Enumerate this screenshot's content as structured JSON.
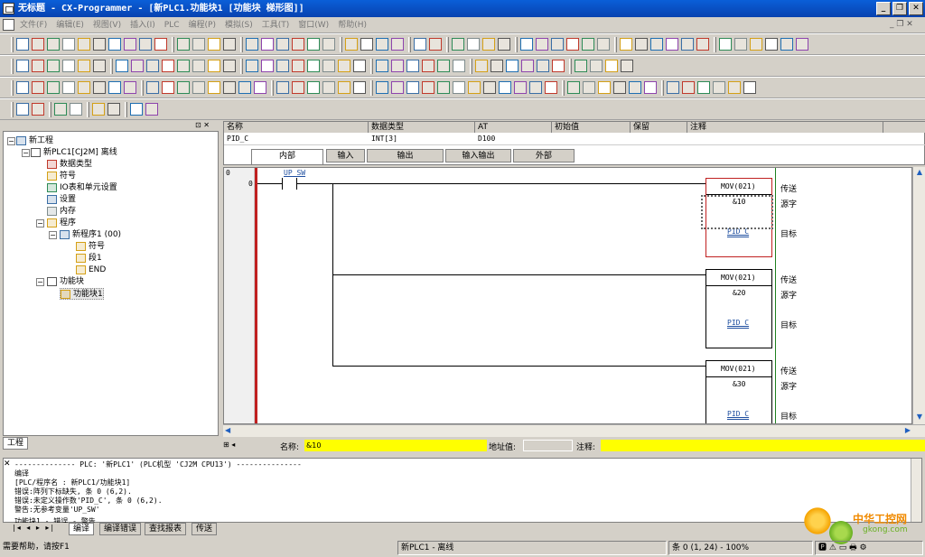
{
  "window": {
    "title": "无标题 - CX-Programmer - [新PLC1.功能块1 [功能块 梯形图]]",
    "min": "_",
    "restore": "❐",
    "close": "✕"
  },
  "menu": [
    "文件(F)",
    "编辑(E)",
    "视图(V)",
    "插入(I)",
    "PLC",
    "编程(P)",
    "模拟(S)",
    "工具(T)",
    "窗口(W)",
    "帮助(H)"
  ],
  "tree": {
    "root": "新工程",
    "plc": "新PLC1[CJ2M] 离线",
    "items": [
      "数据类型",
      "符号",
      "IO表和单元设置",
      "设置",
      "内存",
      "程序",
      "新程序1 (00)",
      "符号",
      "段1",
      "END",
      "功能块",
      "功能块1"
    ],
    "tab": "工程"
  },
  "vartable": {
    "headers": [
      "名称",
      "数据类型",
      "AT",
      "初始值",
      "保留",
      "注释"
    ],
    "row": [
      "PID_C",
      "INT[3]",
      "D100",
      "",
      "",
      ""
    ],
    "tabs": [
      "内部",
      "输入",
      "输出",
      "输入输出",
      "外部"
    ]
  },
  "ladder": {
    "rung_no": "0",
    "step_no": "0",
    "contact": "UP_SW",
    "blocks": [
      {
        "name": "MOV(021)",
        "src": "&10",
        "dst": "PID_C"
      },
      {
        "name": "MOV(021)",
        "src": "&20",
        "dst": "PID_C"
      },
      {
        "name": "MOV(021)",
        "src": "&30",
        "dst": "PID_C"
      }
    ],
    "labels": {
      "transfer": "传送",
      "source": "源字",
      "dest": "目标"
    }
  },
  "infobar": {
    "name_label": "名称:",
    "name_value": "&10",
    "addr_label": "地址值:",
    "comment_label": "注释:"
  },
  "output": {
    "lines": [
      "-------------- PLC: '新PLC1' (PLC机型 'CJ2M CPU13') ---------------",
      "编译",
      "[PLC/程序名 : 新PLC1/功能块1]",
      "错误:阵列下标缺失, 条 0 (6,2).",
      "错误:未定义操作数'PID_C', 条 0 (6,2).",
      "警告:无参考变量'UP_SW'"
    ],
    "partial": "功能块1 - 错误 - 警告",
    "tabs": [
      "编译",
      "编译错误",
      "查找报表",
      "传送"
    ]
  },
  "status": {
    "help": "需要帮助，请按F1",
    "plc": "新PLC1 - 离线",
    "pos": "条 0 (1, 24) - 100%"
  },
  "watermark": {
    "text": "中华工控网",
    "url": "gkong.com"
  }
}
